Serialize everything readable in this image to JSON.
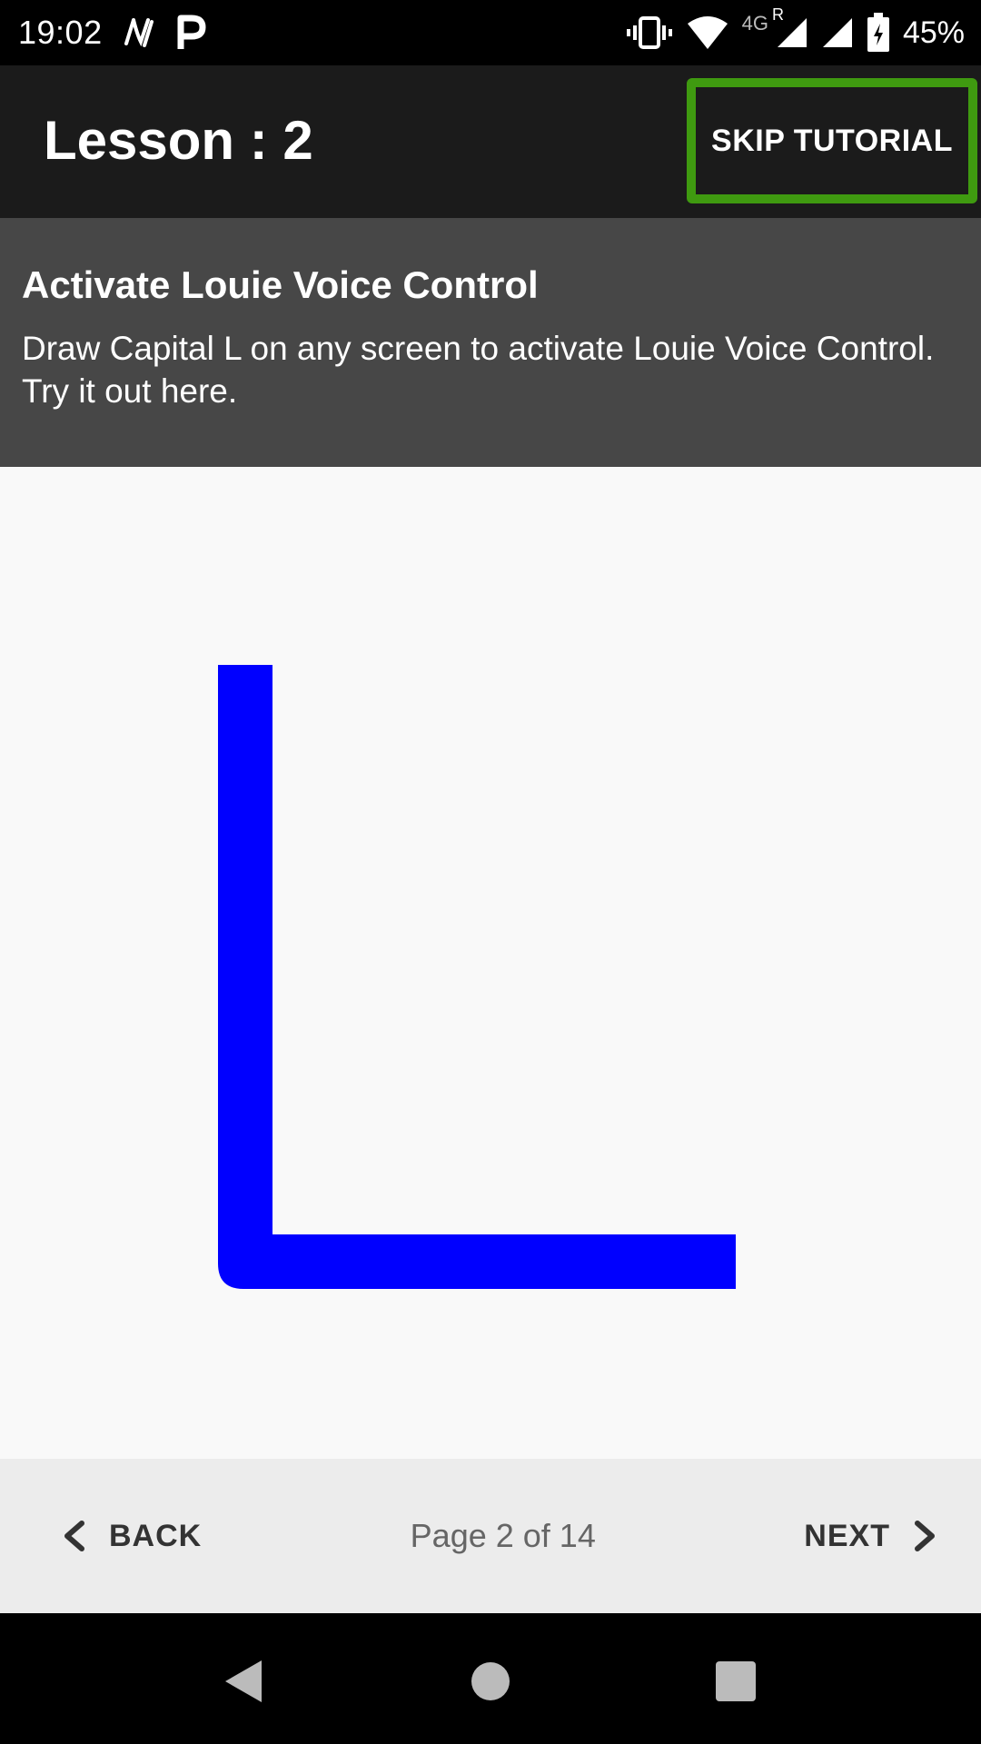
{
  "status_bar": {
    "time": "19:02",
    "network_label": "4G",
    "roaming_label": "R",
    "battery_percent": "45%",
    "icons": [
      "app-n-icon",
      "app-p-icon",
      "vibrate-icon",
      "wifi-icon",
      "signal-icon",
      "signal-2-icon",
      "battery-icon"
    ]
  },
  "app_bar": {
    "title": "Lesson : 2",
    "skip_label": "SKIP TUTORIAL",
    "skip_border_color": "#3f9a10"
  },
  "lesson": {
    "heading": "Activate Louie Voice Control",
    "body": "Draw Capital L on any screen to activate Louie Voice Control. Try it out here."
  },
  "drawing": {
    "stroke_color": "#0000ff",
    "shape": "capital-L"
  },
  "navigation": {
    "back_label": "BACK",
    "page_indicator": "Page 2 of 14",
    "next_label": "NEXT"
  },
  "system_nav": {
    "icons": [
      "back-triangle-icon",
      "home-circle-icon",
      "recents-square-icon"
    ]
  }
}
